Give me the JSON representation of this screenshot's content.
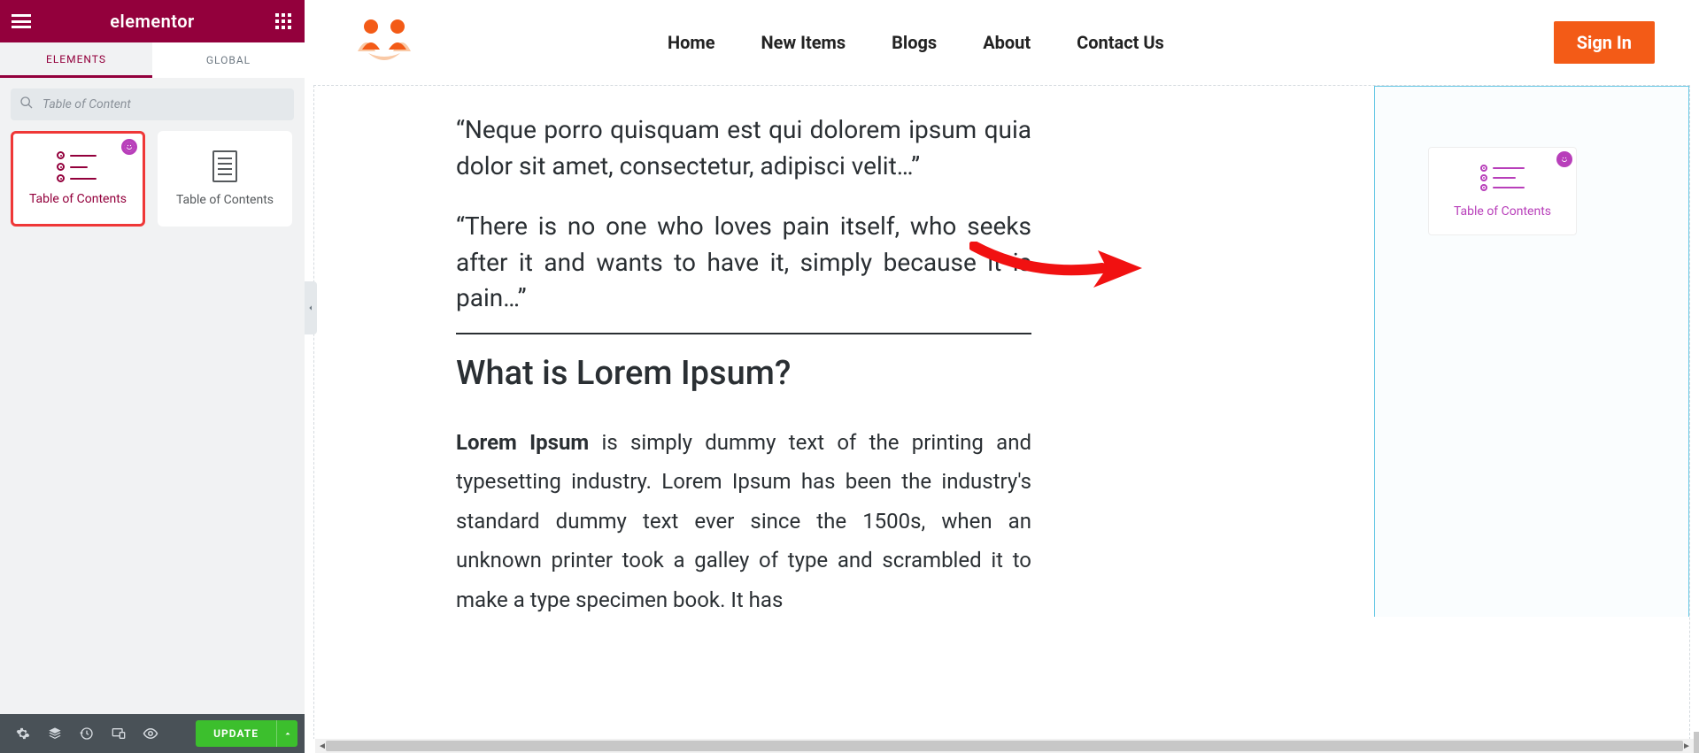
{
  "sidebar": {
    "brand": "elementor",
    "tabs": {
      "elements": "ELEMENTS",
      "global": "GLOBAL"
    },
    "search": {
      "placeholder": "Table of Content",
      "value": ""
    },
    "widgets": {
      "toc_addon": "Table of Contents",
      "toc_basic": "Table of Contents"
    },
    "footer": {
      "update": "UPDATE"
    }
  },
  "site_header": {
    "nav": {
      "home": "Home",
      "new_items": "New Items",
      "blogs": "Blogs",
      "about": "About",
      "contact": "Contact Us"
    },
    "signin": "Sign In"
  },
  "content": {
    "quote1": "“Neque porro quisquam est qui dolorem ipsum quia dolor sit amet, consectetur, adipisci velit…”",
    "quote2": "“There is no one who loves pain itself, who seeks after it and wants to have it, simply because it is pain…”",
    "heading": "What is Lorem Ipsum?",
    "para_lead": "Lorem Ipsum",
    "para_rest": " is simply dummy text of the printing and typesetting industry. Lorem Ipsum has been the industry's standard dummy text ever since the 1500s, when an unknown printer took a galley of type and scrambled it to make a type specimen book. It has"
  },
  "dropzone": {
    "widget_label": "Table of Contents"
  }
}
